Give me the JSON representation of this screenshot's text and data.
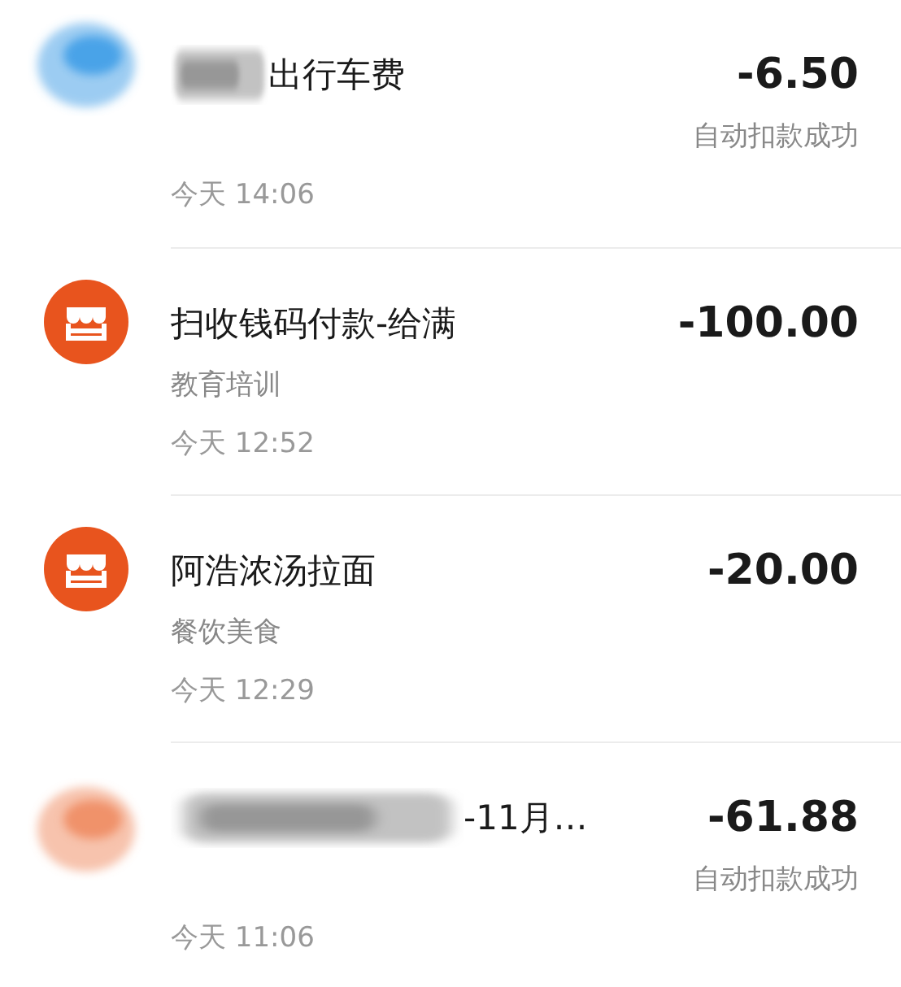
{
  "transactions": [
    {
      "kind": "redacted",
      "color": "#4aa3e8",
      "title": "出行车费",
      "amount": "-6.50",
      "status": "自动扣款成功",
      "time": "今天 14:06"
    },
    {
      "kind": "merchant",
      "color": "#e8541e",
      "title": "扫收钱码付款-给满",
      "amount": "-100.00",
      "category": "教育培训",
      "time": "今天 12:52"
    },
    {
      "kind": "merchant",
      "color": "#e8541e",
      "title": "阿浩浓汤拉面",
      "amount": "-20.00",
      "category": "餐饮美食",
      "time": "今天 12:29"
    },
    {
      "kind": "redacted",
      "color": "#f0926a",
      "title": "-11月…",
      "amount": "-61.88",
      "status": "自动扣款成功",
      "time": "今天 11:06"
    }
  ]
}
